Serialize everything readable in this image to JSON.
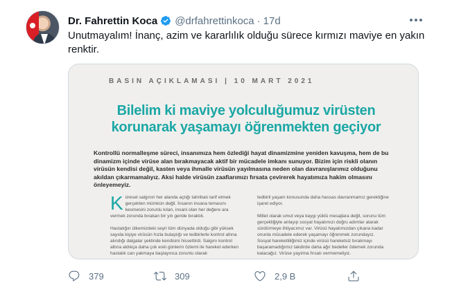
{
  "tweet": {
    "author_name": "Dr. Fahrettin Koca",
    "handle": "@drfahrettinkoca",
    "separator": "·",
    "time": "17d",
    "text": "Unutmayalım! İnanç, azim ve kararlılık olduğu sürece kırmızı maviye en yakın renktir."
  },
  "media": {
    "kicker": "BASIN AÇIKLAMASI | 10 MART 2021",
    "headline": "Bilelim ki maviye yolculuğumuz virüsten korunarak yaşamayı öğrenmekten geçiyor",
    "lead": "Kontrollü normalleşme süreci, insanımıza hem özlediği hayat dinamizmine yeniden kavuşma, hem de bu dinamizm içinde virüse alan bırakmayacak aktif bir mücadele imkanı sunuyor.  Bizim için riskli olanın virüsün kendisi değil, kasten veya ihmalle virüsün yayılmasına neden olan davranışlarımız olduğunu akıldan çıkarmamalıyız. Aksi halde virüsün zaafiarımızı fırsata çevirerek hayatımıza hakim olmasını önleyemeyiz.",
    "col_left_dropcap": "K",
    "col_left_1": "üresel salgının her alanda açtığı tahribatı tarif etmek gerçekten mümkün değil. İnsanın insana temasını kesmesini zorunlu kılan, insani olan her değere ara vermek zorunda bırakan bir yılı geride bıraktık.",
    "col_left_2": "Hastalığın ülkemizdeki seyri tüm dünyada olduğu gibi yüksek sayıda kişiye virüsün hızla bulaştığı ve tedbirlerle kontrol altına alındığı dalgalar şeklinde kendisini hissettirdi. Salgını kontrol altına aldıkça daha çok eski günlerin özlemi ile hareket ederken hastalık can yakmaya başlayınca zorunlu olarak",
    "col_right_1": "tedbirli yaşam konusunda daha hassas davranmamız gerektiğine işaret ediyor.",
    "col_right_2": "Millet olarak umut veya kaygı yüklü mesajlara değil, sorunu tüm gerçekliğiyle anlayıp sosyal hayatımızı doğru adımlar atarak sürdürmeye ihtiyacımız var. Virüsü hayatımızdan çıkana kadar onunla mücadele ederek yaşamayı öğrenmek zorundayız. Sosyal hareketliliğimiz içinde virüsü hareketsiz bırakmayı başaramadığımız takdirde daha ağır bedeller ödemek zorunda kalacağız. Virüse yayılma fırsatı vermemeliyiz."
  },
  "actions": {
    "reply_count": "379",
    "retweet_count": "309",
    "like_count": "2,9 B"
  },
  "colors": {
    "accent_teal": "#1ba7a5",
    "verified_blue": "#1d9bf0",
    "muted": "#5b7083"
  },
  "icons": [
    "verified-badge-icon",
    "more-icon",
    "reply-icon",
    "retweet-icon",
    "like-icon",
    "share-icon"
  ]
}
